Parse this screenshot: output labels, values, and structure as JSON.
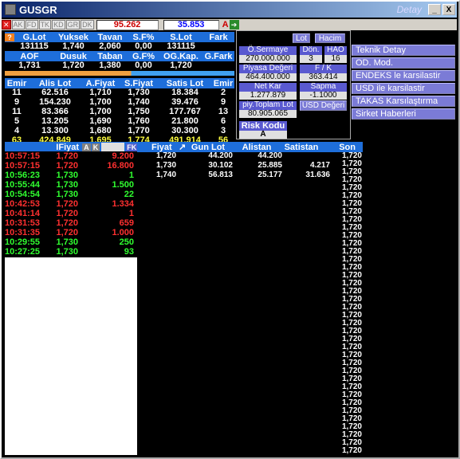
{
  "window": {
    "title": "GUSGR",
    "detay": "Detay",
    "min": "_",
    "close": "X"
  },
  "toolbar": {
    "buttons": [
      "AK",
      "FD",
      "TK",
      "KD",
      "GR",
      "DK"
    ],
    "price1": "95.262",
    "price2": "35.853",
    "a_label": "A"
  },
  "summary": {
    "headers1": [
      "G.Lot",
      "Yuksek",
      "Tavan",
      "S.F%",
      "S.Lot",
      "Fark"
    ],
    "values1": [
      "131115",
      "1,740",
      "2,060",
      "0,00",
      "131115",
      ""
    ],
    "headers2": [
      "AOF",
      "Dusuk",
      "Taban",
      "G.F%",
      "OG.Kap.",
      "G.Fark"
    ],
    "values2": [
      "1,731",
      "1,720",
      "1,380",
      "0,00",
      "1,720",
      ""
    ]
  },
  "depth": {
    "headers": [
      "Emir",
      "Alis Lot",
      "A.Fiyat",
      "S.Fiyat",
      "Satis Lot",
      "Emir"
    ],
    "rows": [
      [
        "11",
        "62.516",
        "1,710",
        "1,730",
        "18.384",
        "2"
      ],
      [
        "9",
        "154.230",
        "1,700",
        "1,740",
        "39.476",
        "9"
      ],
      [
        "11",
        "83.366",
        "1,700",
        "1,750",
        "177.767",
        "13"
      ],
      [
        "5",
        "13.205",
        "1,690",
        "1,760",
        "21.800",
        "6"
      ],
      [
        "4",
        "13.300",
        "1,680",
        "1,770",
        "30.300",
        "3"
      ]
    ],
    "total": [
      "63",
      "424.849",
      "1,695",
      "1,774",
      "491.914",
      "56"
    ]
  },
  "panel": {
    "lot_btn": "Lot",
    "hacim_btn": "Hacim",
    "osermaye_label": "Ö.Sermaye",
    "osermaye_value": "270.000.000",
    "don_label": "Dön.",
    "don_value": "3",
    "hao_label": "HAO",
    "hao_value": "16",
    "piyasa_label": "Piyasa Değeri",
    "piyasa_value": "464.400.000",
    "fk_label": "F / K",
    "fk_value": "363.414",
    "netkar_label": "Net Kar",
    "netkar_value": "1.277.879",
    "sapma_label": "Sapma",
    "sapma_value": "-1.1000",
    "piytoplam_label": "piy.Toplam Lot",
    "piytoplam_value": "80.905.065",
    "usd_label": "USD Değeri",
    "risk_label": "Risk Kodu",
    "risk_value": "A"
  },
  "menu": [
    "Teknik Detay",
    "OD. Mod.",
    "ENDEKS le karsilastir",
    "USD ile karsilastir",
    "TAKAS Karsılaştırma",
    "Sirket Haberleri"
  ],
  "trades": {
    "header_fiyat": "IFiyat",
    "a": "A",
    "k": "K",
    "fk": "FK",
    "rows": [
      {
        "t": "10:57:15",
        "p": "1,720",
        "v": "9.200",
        "c": "red"
      },
      {
        "t": "10:57:15",
        "p": "1,720",
        "v": "16.800",
        "c": "red"
      },
      {
        "t": "10:56:23",
        "p": "1,730",
        "v": "1",
        "c": "green"
      },
      {
        "t": "10:55:44",
        "p": "1,730",
        "v": "1.500",
        "c": "green"
      },
      {
        "t": "10:54:54",
        "p": "1,730",
        "v": "22",
        "c": "green"
      },
      {
        "t": "10:42:53",
        "p": "1,720",
        "v": "1.334",
        "c": "red"
      },
      {
        "t": "10:41:14",
        "p": "1,720",
        "v": "1",
        "c": "red"
      },
      {
        "t": "10:31:53",
        "p": "1,720",
        "v": "659",
        "c": "red"
      },
      {
        "t": "10:31:35",
        "p": "1,720",
        "v": "1.000",
        "c": "red"
      },
      {
        "t": "10:29:55",
        "p": "1,730",
        "v": "250",
        "c": "green"
      },
      {
        "t": "10:27:25",
        "p": "1,730",
        "v": "93",
        "c": "green"
      }
    ]
  },
  "pricelevels": {
    "headers": [
      "Fiyat",
      "Gun Lot",
      "Alistan",
      "Satistan",
      "Son"
    ],
    "rows": [
      [
        "1,720",
        "44.200",
        "44.200",
        ""
      ],
      [
        "1,730",
        "30.102",
        "25.885",
        "4.217"
      ],
      [
        "1,740",
        "56.813",
        "25.177",
        "31.636"
      ]
    ],
    "son": "1,720",
    "son_count": 38
  }
}
